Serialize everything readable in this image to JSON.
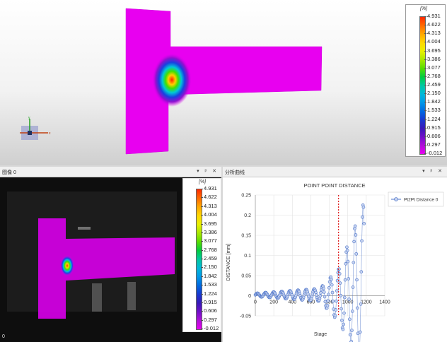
{
  "legend": {
    "unit": "[%]",
    "values": [
      "4.931",
      "4.622",
      "4.313",
      "4.004",
      "3.695",
      "3.386",
      "3.077",
      "2.768",
      "2.459",
      "2.150",
      "1.842",
      "1.533",
      "1.224",
      "0.915",
      "0.606",
      "0.297",
      "-0.012"
    ],
    "colors": [
      "#ff2a00",
      "#ff6a00",
      "#ffa800",
      "#ffd800",
      "#e8f000",
      "#a8e800",
      "#58dd00",
      "#00cc40",
      "#00c8a0",
      "#00b8d8",
      "#0098e8",
      "#0068e0",
      "#1838d0",
      "#3818b8",
      "#7010c8",
      "#b010d8",
      "#e800f0"
    ]
  },
  "image_panel": {
    "title": "图像 0",
    "controls": "▾ ᵖ ✕",
    "frame_index": "0"
  },
  "chart_panel": {
    "title": "分析曲线",
    "controls": "▾ ᵖ ✕"
  },
  "axis_triad": {
    "x": "x",
    "y": "y"
  },
  "chart_data": {
    "type": "scatter",
    "title": "POINT POINT DISTANCE",
    "xlabel": "Stage",
    "ylabel": "DISTANCE [mm]",
    "xlim": [
      0,
      1400
    ],
    "ylim": [
      -0.05,
      0.25
    ],
    "xticks": [
      0,
      200,
      400,
      600,
      800,
      1000,
      1200,
      1400
    ],
    "yticks": [
      -0.05,
      0,
      0.05,
      0.1,
      0.15,
      0.2,
      0.25
    ],
    "vline_x": 900,
    "legend_position": "top-right",
    "series": [
      {
        "name": "Pt2Pt Distance 0",
        "color": "#4a72c8"
      }
    ]
  }
}
